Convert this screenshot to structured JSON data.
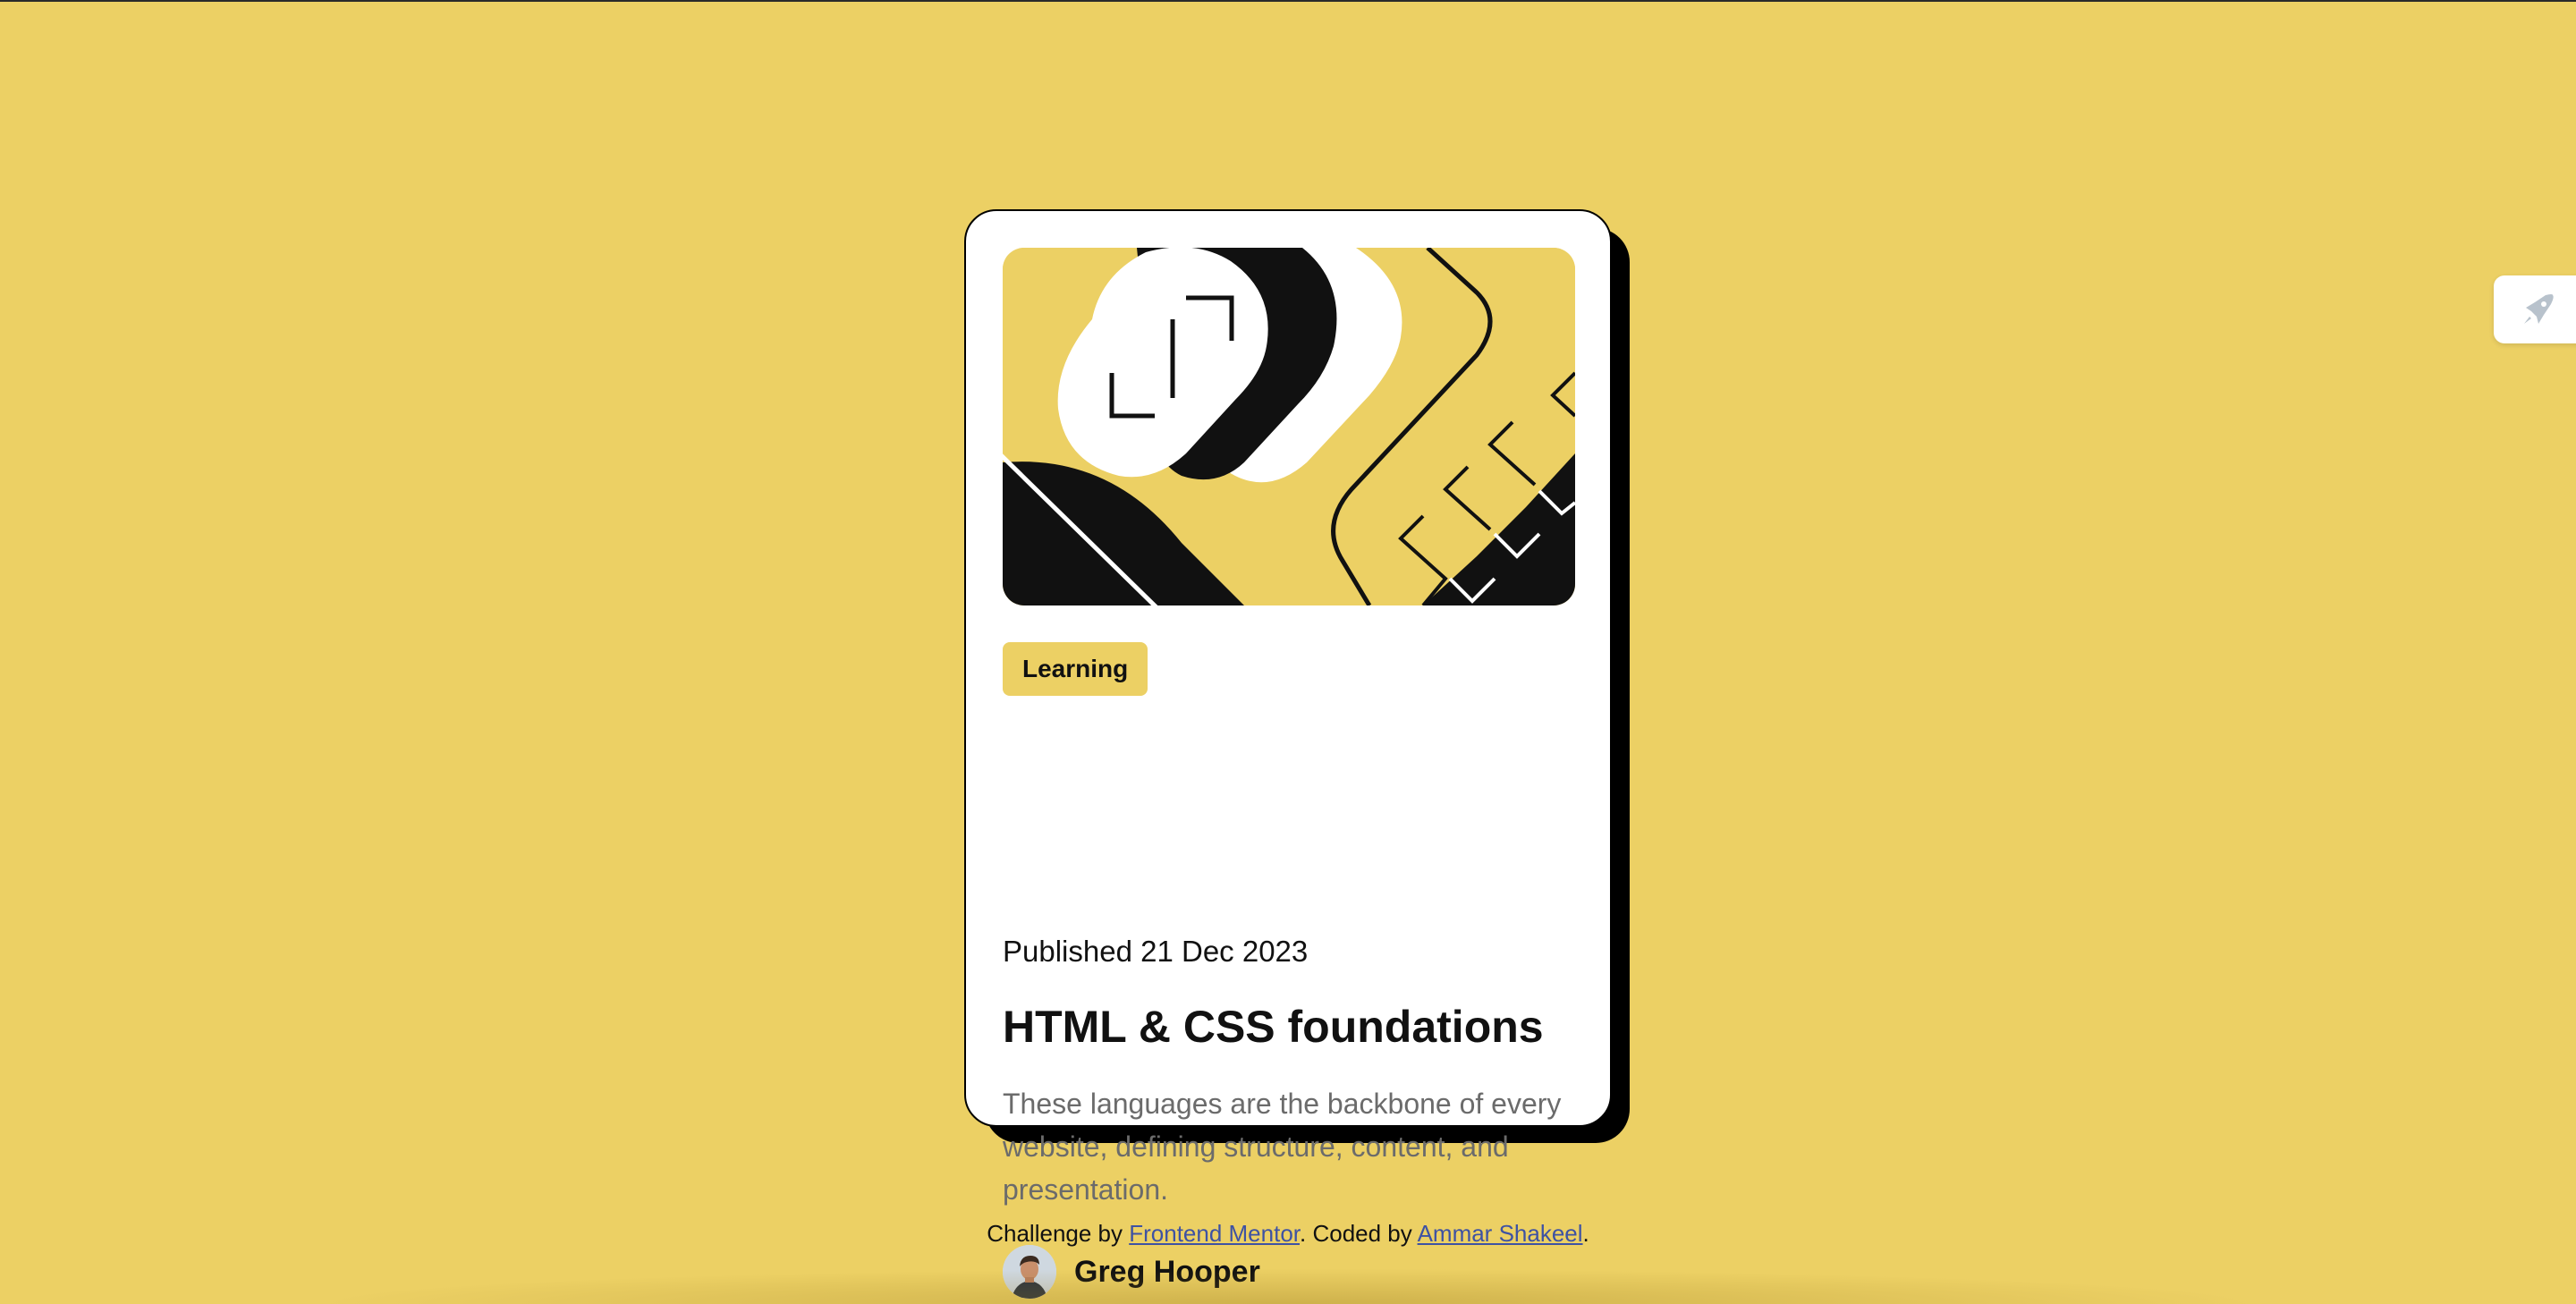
{
  "card": {
    "tag": "Learning",
    "published": "Published 21 Dec 2023",
    "title": "HTML & CSS foundations",
    "description": "These languages are the backbone of every website, defining structure, content, and presentation.",
    "author": "Greg Hooper",
    "hero_icon": "html-css-illustration",
    "avatar_icon": "person-avatar"
  },
  "footer": {
    "prefix": "Challenge by ",
    "link1": "Frontend Mentor",
    "middle": ". Coded by ",
    "link2": "Ammar Shakeel",
    "suffix": "."
  },
  "side_widget": {
    "icon": "rocket-icon"
  },
  "colors": {
    "background": "#ecd064",
    "card": "#ffffff",
    "ink": "#111111",
    "muted": "#6b6b6b",
    "link": "#3e52a3"
  }
}
